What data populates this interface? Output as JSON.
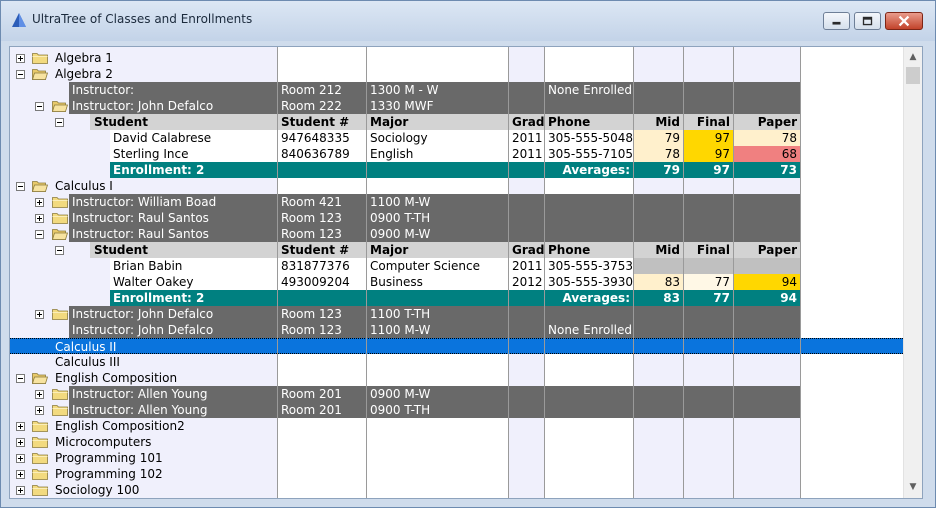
{
  "window": {
    "title": "UltraTree of Classes and Enrollments",
    "buttons": {
      "minimize": "minimize",
      "maximize": "maximize",
      "close": "close"
    }
  },
  "colors": {
    "instructor_row": "#696969",
    "header_row": "#d3d3d3",
    "enrollment_row": "#008080",
    "selection": "#0a74dd",
    "light_yellow": "#fff0cc",
    "gold": "#ffd700",
    "light_red": "#f08080"
  },
  "tree": {
    "algebra1": "Algebra 1",
    "algebra2": "Algebra 2",
    "alg2_instr1": {
      "instructor": "Instructor:",
      "room": "Room 212",
      "time": "1300 M - W",
      "status": "None Enrolled"
    },
    "alg2_instr2": {
      "instructor": "Instructor: John Defalco",
      "room": "Room 222",
      "time": "1330 MWF"
    },
    "header1": {
      "student": "Student",
      "student_no": "Student #",
      "major": "Major",
      "grad": "Grad",
      "phone": "Phone",
      "mid": "Mid",
      "final": "Final",
      "paper": "Paper"
    },
    "alg2_s1": {
      "name": "David Calabrese",
      "id": "947648335",
      "major": "Sociology",
      "grad": "2011",
      "phone": "305-555-5048",
      "mid": "79",
      "final": "97",
      "paper": "78"
    },
    "alg2_s2": {
      "name": "Sterling Ince",
      "id": "840636789",
      "major": "English",
      "grad": "2011",
      "phone": "305-555-7105",
      "mid": "78",
      "final": "97",
      "paper": "68"
    },
    "alg2_sum": {
      "enrollment": "Enrollment: 2",
      "averages": "Averages:",
      "mid": "79",
      "final": "97",
      "paper": "73"
    },
    "calc1": "Calculus I",
    "calc1_i1": {
      "instructor": "Instructor: William Boad",
      "room": "Room 421",
      "time": "1100 M-W"
    },
    "calc1_i2": {
      "instructor": "Instructor: Raul Santos",
      "room": "Room 123",
      "time": "0900 T-TH"
    },
    "calc1_i3": {
      "instructor": "Instructor: Raul Santos",
      "room": "Room 123",
      "time": "0900 M-W"
    },
    "header2": {
      "student": "Student",
      "student_no": "Student #",
      "major": "Major",
      "grad": "Grad",
      "phone": "Phone",
      "mid": "Mid",
      "final": "Final",
      "paper": "Paper"
    },
    "calc1_s1": {
      "name": "Brian Babin",
      "id": "831877376",
      "major": "Computer Science",
      "grad": "2011",
      "phone": "305-555-3753",
      "mid": "",
      "final": "",
      "paper": ""
    },
    "calc1_s2": {
      "name": "Walter Oakey",
      "id": "493009204",
      "major": "Business",
      "grad": "2012",
      "phone": "305-555-3930",
      "mid": "83",
      "final": "77",
      "paper": "94"
    },
    "calc1_sum": {
      "enrollment": "Enrollment: 2",
      "averages": "Averages:",
      "mid": "83",
      "final": "77",
      "paper": "94"
    },
    "calc1_i4": {
      "instructor": "Instructor: John Defalco",
      "room": "Room 123",
      "time": "1100 T-TH"
    },
    "calc1_i5": {
      "instructor": "Instructor: John Defalco",
      "room": "Room 123",
      "time": "1100 M-W",
      "status": "None Enrolled"
    },
    "calc2": "Calculus II",
    "calc3": "Calculus III",
    "engcomp": "English Composition",
    "eng_i1": {
      "instructor": "Instructor: Allen Young",
      "room": "Room 201",
      "time": "0900 M-W"
    },
    "eng_i2": {
      "instructor": "Instructor: Allen Young",
      "room": "Room 201",
      "time": "0900 T-TH"
    },
    "engcomp2": "English Composition2",
    "micro": "Microcomputers",
    "prog101": "Programming 101",
    "prog102": "Programming 102",
    "soc100": "Sociology 100"
  },
  "scrollbar": {
    "up": "▲",
    "down": "▼"
  }
}
